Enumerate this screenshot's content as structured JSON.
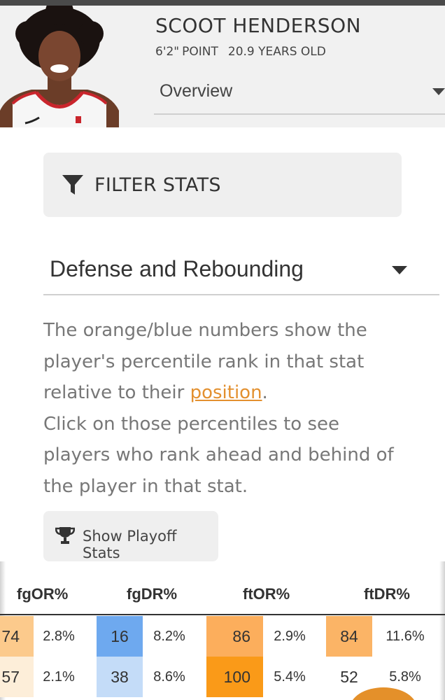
{
  "player": {
    "name": "SCOOT HENDERSON",
    "height": "6'2\"",
    "position": "POINT",
    "age": "20.9 YEARS OLD"
  },
  "view_select": {
    "value": "Overview"
  },
  "filter_button": {
    "label": "FILTER STATS",
    "icon": "filter-icon"
  },
  "stat_select": {
    "value": "Defense and Rebounding"
  },
  "description": {
    "line1": "The orange/blue numbers show the player's percentile rank in that stat relative to their ",
    "link": "position",
    "line1_end": ".",
    "line2": "Click on those percentiles to see players who rank ahead and behind of the player in that stat."
  },
  "playoff_button": {
    "label": "Show Playoff Stats",
    "icon": "trophy-icon"
  },
  "table": {
    "headers": [
      "fgOR%",
      "fgDR%",
      "ftOR%",
      "ftDR%"
    ],
    "rows": [
      {
        "pct": [
          "74",
          "16",
          "86",
          "84"
        ],
        "val": [
          "2.8%",
          "8.2%",
          "2.9%",
          "11.6%"
        ]
      },
      {
        "pct": [
          "57",
          "38",
          "100",
          "52"
        ],
        "val": [
          "2.1%",
          "8.6%",
          "5.4%",
          "5.8%"
        ]
      }
    ]
  },
  "colors": {
    "accent_orange": "#e3902f",
    "pct_74": "#fcca8c",
    "pct_16": "#6ea9ef",
    "pct_86": "#fcae5c",
    "pct_84": "#fbb466",
    "pct_57": "#fdeed9",
    "pct_38": "#c4dcf8",
    "pct_100": "#fa9a18",
    "pct_52": "#ffffff"
  }
}
